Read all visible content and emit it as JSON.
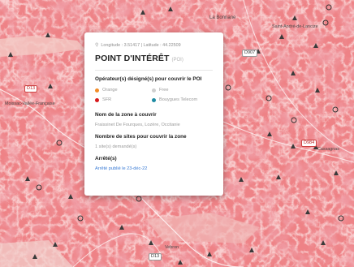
{
  "map": {
    "place_labels": [
      "La Bonnane",
      "Saint-André-de-Lancize",
      "Moissac-Vallée-Française",
      "Cassagnas",
      "Vebron"
    ],
    "road_labels": [
      "D907",
      "D13",
      "D984",
      "D13"
    ],
    "colors": {
      "coverage": "#ef7f83",
      "coverage_dark": "#e05a60",
      "popup_bg": "#ffffff",
      "link": "#3a7bd5"
    }
  },
  "popup": {
    "icon": "location-pin-icon",
    "coords": "Longitude : 3.51417  |  Latitude : 44.22509",
    "title": "POINT D'INTÉRÊT",
    "tag": "(POI)",
    "operators_heading": "Opérateur(s) désigné(s) pour couvrir le POI",
    "operators": [
      {
        "name": "Orange",
        "color": "#f28c28"
      },
      {
        "name": "Free",
        "color": "#cfcfcf"
      },
      {
        "name": "SFR",
        "color": "#d7191c"
      },
      {
        "name": "Bouygues Telecom",
        "color": "#1e8ba3"
      }
    ],
    "zone_heading": "Nom de la zone à couvrir",
    "zone_value": "Fraissinet De Fourques, Lozère, Occitanie",
    "sites_heading": "Nombre de sites pour couvrir la zone",
    "sites_value": "1 site(s) demandé(s)",
    "arrete_heading": "Arrêté(s)",
    "arrete_link": "Arrêté publié le 23-déc-22"
  }
}
